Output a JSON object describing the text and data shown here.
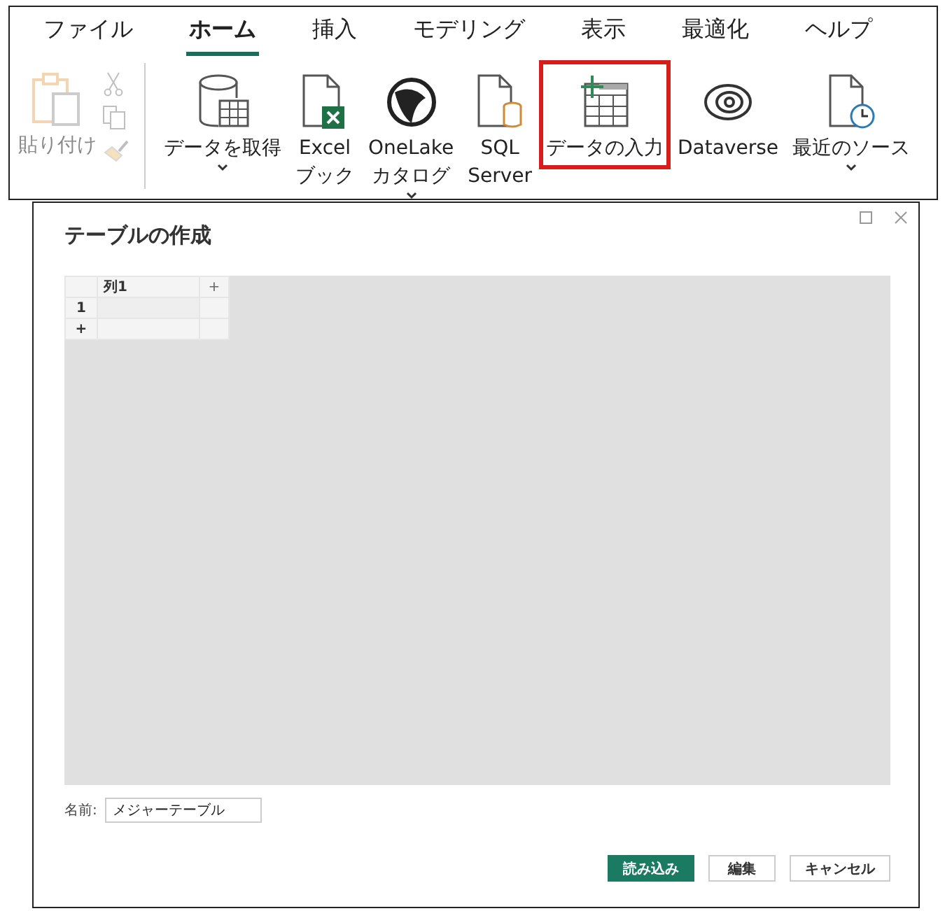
{
  "tabs": [
    {
      "label": "ファイル",
      "selected": false
    },
    {
      "label": "ホーム",
      "selected": true
    },
    {
      "label": "挿入",
      "selected": false
    },
    {
      "label": "モデリング",
      "selected": false
    },
    {
      "label": "表示",
      "selected": false
    },
    {
      "label": "最適化",
      "selected": false
    },
    {
      "label": "ヘルプ",
      "selected": false
    }
  ],
  "clipboard": {
    "paste_label": "貼り付け",
    "disabled": true
  },
  "ribbon_items": [
    {
      "kind": "database",
      "lines": [
        "データを取得"
      ],
      "has_menu": true,
      "highlighted": false
    },
    {
      "kind": "excel",
      "lines": [
        "Excel",
        "ブック"
      ],
      "has_menu": false,
      "highlighted": false
    },
    {
      "kind": "onelake",
      "lines": [
        "OneLake",
        "カタログ"
      ],
      "has_menu": true,
      "highlighted": false
    },
    {
      "kind": "sql",
      "lines": [
        "SQL",
        "Server"
      ],
      "has_menu": false,
      "highlighted": false
    },
    {
      "kind": "table",
      "lines": [
        "データの入力"
      ],
      "has_menu": false,
      "highlighted": true
    },
    {
      "kind": "dataverse",
      "lines": [
        "Dataverse"
      ],
      "has_menu": false,
      "highlighted": false
    },
    {
      "kind": "recent",
      "lines": [
        "最近のソース"
      ],
      "has_menu": true,
      "highlighted": false
    }
  ],
  "dialog": {
    "title": "テーブルの作成",
    "grid": {
      "header": [
        "列1"
      ],
      "add_column": "+",
      "rows": [
        {
          "label": "1",
          "cells": [
            ""
          ]
        }
      ],
      "add_row": "+"
    },
    "name_label": "名前:",
    "name_value": "メジャーテーブル",
    "buttons": [
      {
        "label": "読み込み",
        "primary": true
      },
      {
        "label": "編集",
        "primary": false
      },
      {
        "label": "キャンセル",
        "primary": false
      }
    ]
  }
}
